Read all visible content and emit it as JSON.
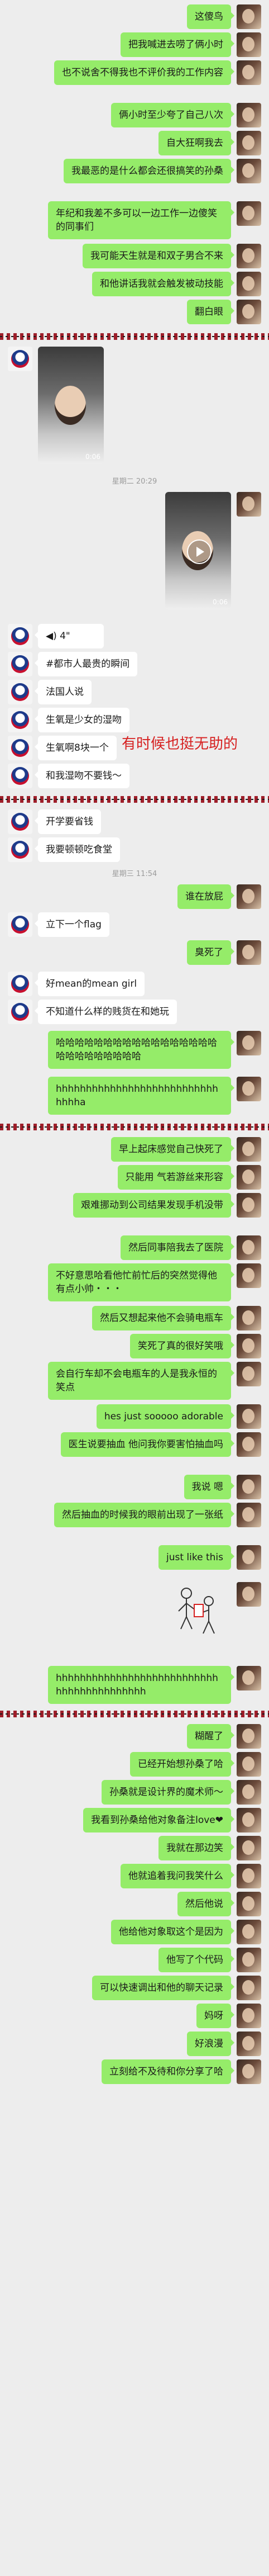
{
  "messages": [
    {
      "side": "right",
      "text": "这傻鸟"
    },
    {
      "side": "right",
      "text": "把我喊进去唠了俩小时"
    },
    {
      "side": "right",
      "text": "也不说舍不得我也不评价我的工作内容"
    },
    {
      "side": "right",
      "text": "俩小时至少夸了自己八次"
    },
    {
      "side": "right",
      "text": "自大狂啊我去"
    },
    {
      "side": "right",
      "text": "我最恶的是什么都会还很搞笑的孙桑"
    },
    {
      "side": "right",
      "text": "年纪和我差不多可以一边工作一边傻笑的同事们"
    },
    {
      "side": "right",
      "text": "我可能天生就是和双子男合不来"
    },
    {
      "side": "right",
      "text": "和他讲话我就会触发被动技能"
    },
    {
      "side": "right",
      "text": "翻白眼"
    },
    {
      "side": "left",
      "text": "◀) 4\""
    },
    {
      "side": "left",
      "text": "#都市人最贵的瞬间"
    },
    {
      "side": "left",
      "text": "法国人说"
    },
    {
      "side": "left",
      "text": "生氧是少女的湿吻"
    },
    {
      "side": "left",
      "text": "生氧啊8块一个"
    },
    {
      "side": "left",
      "text": "和我湿吻不要钱～"
    },
    {
      "side": "left",
      "text": "开学要省钱"
    },
    {
      "side": "left",
      "text": "我要顿顿吃食堂"
    },
    {
      "side": "right",
      "text": "谁在放屁"
    },
    {
      "side": "left",
      "text": "立下一个flag"
    },
    {
      "side": "right",
      "text": "臭死了"
    },
    {
      "side": "left",
      "text": "好mean的mean girl"
    },
    {
      "side": "left",
      "text": "不知道什么样的贱货在和她玩"
    },
    {
      "side": "right",
      "text": "哈哈哈哈哈哈哈哈哈哈哈哈哈哈哈哈哈哈哈哈哈哈哈哈哈哈"
    },
    {
      "side": "right",
      "text": "hhhhhhhhhhhhhhhhhhhhhhhhhhhhhhha"
    },
    {
      "side": "right",
      "text": "早上起床感觉自己快死了"
    },
    {
      "side": "right",
      "text": "只能用 气若游丝来形容"
    },
    {
      "side": "right",
      "text": "艰难挪动到公司结果发现手机没带"
    },
    {
      "side": "right",
      "text": "然后同事陪我去了医院"
    },
    {
      "side": "right",
      "text": "不好意思哈看他忙前忙后的突然觉得他有点小帅・・・"
    },
    {
      "side": "right",
      "text": "然后又想起来他不会骑电瓶车"
    },
    {
      "side": "right",
      "text": "笑死了真的很好笑哦"
    },
    {
      "side": "right",
      "text": "会自行车却不会电瓶车的人是我永恒的笑点"
    },
    {
      "side": "right",
      "text": "hes just sooooo adorable"
    },
    {
      "side": "right",
      "text": "医生说要抽血 他问我你要害怕抽血吗"
    },
    {
      "side": "right",
      "text": "我说 嗯"
    },
    {
      "side": "right",
      "text": "然后抽血的时候我的眼前出现了一张纸"
    },
    {
      "side": "right",
      "text": "just like this"
    },
    {
      "side": "right",
      "text": "hhhhhhhhhhhhhhhhhhhhhhhhhhhhhhhhhhhhhhhhhh"
    },
    {
      "side": "right",
      "text": "糊醒了"
    },
    {
      "side": "right",
      "text": "已经开始想孙桑了哈"
    },
    {
      "side": "right",
      "text": "孙桑就是设计界的魔术师～"
    },
    {
      "side": "right",
      "text": "我看到孙桑给他对象备注love❤"
    },
    {
      "side": "right",
      "text": "我就在那边笑"
    },
    {
      "side": "right",
      "text": "他就追着我问我笑什么"
    },
    {
      "side": "right",
      "text": "然后他说"
    },
    {
      "side": "right",
      "text": "他给他对象取这个是因为"
    },
    {
      "side": "right",
      "text": "他写了个代码"
    },
    {
      "side": "right",
      "text": "可以快速调出和他的聊天记录"
    },
    {
      "side": "right",
      "text": "妈呀"
    },
    {
      "side": "right",
      "text": "好浪漫"
    },
    {
      "side": "right",
      "text": "立刻给不及待和你分享了哈"
    }
  ],
  "timestamps": [
    "星期二 20:29",
    "星期三 11:54"
  ],
  "videos": [
    {
      "duration": "0:06"
    },
    {
      "duration": "0:06"
    }
  ],
  "overlay_text": "有时候也挺无助的",
  "colors": {
    "bg": "#ededed",
    "me_bubble": "#95ec69",
    "friend_bubble": "#ffffff",
    "overlay": "#d62020"
  }
}
